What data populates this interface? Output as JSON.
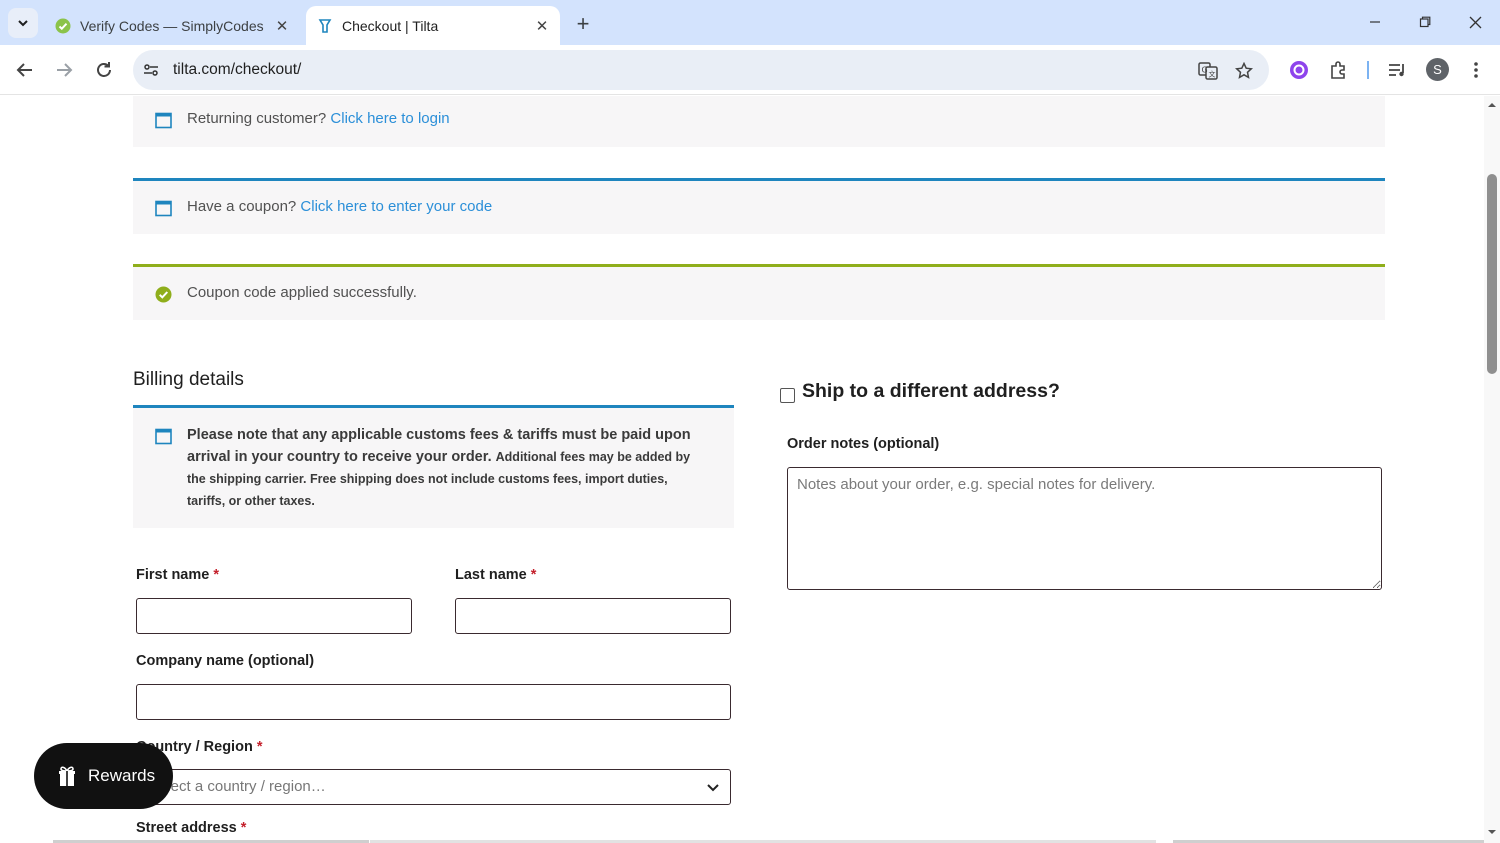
{
  "browser": {
    "tabs": [
      {
        "title": "Verify Codes — SimplyCodes",
        "active": false,
        "favicon": "simplycodes-icon"
      },
      {
        "title": "Checkout | Tilta",
        "active": true,
        "favicon": "tilta-icon"
      }
    ],
    "url": "tilta.com/checkout/",
    "profile_initial": "S"
  },
  "notices": {
    "login": {
      "text": "Returning customer?",
      "link": "Click here to login"
    },
    "coupon": {
      "text": "Have a coupon?",
      "link": "Click here to enter your code"
    },
    "success": {
      "text": "Coupon code applied successfully."
    }
  },
  "billing": {
    "title": "Billing details",
    "info_bold": "Please note that any applicable customs fees & tariffs must be paid upon arrival in your country to receive your order.",
    "info_small": "Additional fees may be added by the shipping carrier. Free shipping does not include customs fees, import duties, tariffs, or other taxes.",
    "first_name_label": "First name",
    "last_name_label": "Last name",
    "company_label": "Company name (optional)",
    "country_label": "Country / Region",
    "country_placeholder": "Select a country / region…",
    "street_label": "Street address",
    "required_mark": "*"
  },
  "shipping": {
    "ship_label": "Ship to a different address?",
    "notes_label": "Order notes (optional)",
    "notes_placeholder": "Notes about your order, e.g. special notes for delivery."
  },
  "rewards": {
    "label": "Rewards"
  },
  "colors": {
    "link": "#2b8fd8",
    "info_border": "#1e85be",
    "success_border": "#8fae1b",
    "required": "#c4202b"
  }
}
